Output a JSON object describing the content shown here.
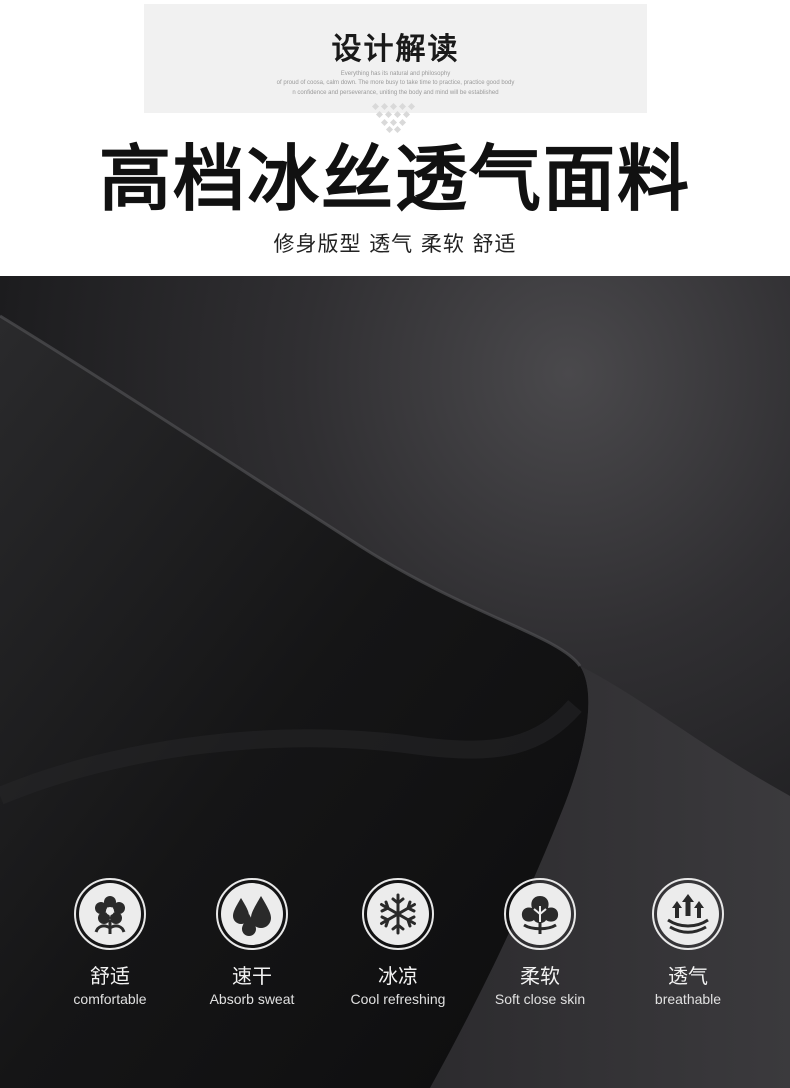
{
  "header": {
    "design_title": "设计解读",
    "design_sub_1": "Everything has its natural and philosophy",
    "design_sub_2": "of proud of coosa, calm down. The more busy to take time to practice, practice good body",
    "design_sub_3": "n confidence and perseverance, uniting the body and mind will be established",
    "main_title": "高档冰丝透气面料",
    "subtitle": "修身版型 透气 柔软 舒适"
  },
  "features": [
    {
      "icon": "flower-icon",
      "cn": "舒适",
      "en": "comfortable"
    },
    {
      "icon": "water-drops-icon",
      "cn": "速干",
      "en": "Absorb sweat"
    },
    {
      "icon": "snowflake-icon",
      "cn": "冰凉",
      "en": "Cool refreshing"
    },
    {
      "icon": "cotton-icon",
      "cn": "柔软",
      "en": "Soft close skin"
    },
    {
      "icon": "breathable-arrows-icon",
      "cn": "透气",
      "en": "breathable"
    }
  ],
  "colors": {
    "background": "#ffffff",
    "fabric": "#1b1b1c",
    "icon_fill": "#ececec",
    "text_dark": "#111111"
  }
}
